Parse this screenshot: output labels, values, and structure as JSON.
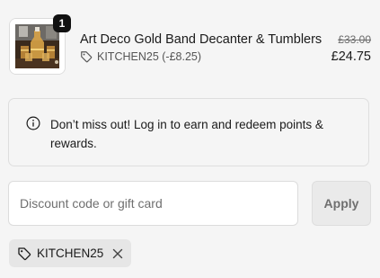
{
  "cart": {
    "item": {
      "title": "Art Deco Gold Band Decanter & Tumblers",
      "quantity": "1",
      "discount_label": "KITCHEN25 (-£8.25)",
      "price_original": "£33.00",
      "price_final": "£24.75",
      "thumbnail_icon": "decanter-image"
    }
  },
  "notice": {
    "text": "Don’t miss out! Log in to earn and redeem points & rewards.",
    "icon": "info-icon"
  },
  "discount": {
    "placeholder": "Discount code or gift card",
    "value": "",
    "apply_label": "Apply",
    "applied_code": "KITCHEN25",
    "tag_icon": "tag-icon",
    "remove_icon": "close-icon"
  }
}
